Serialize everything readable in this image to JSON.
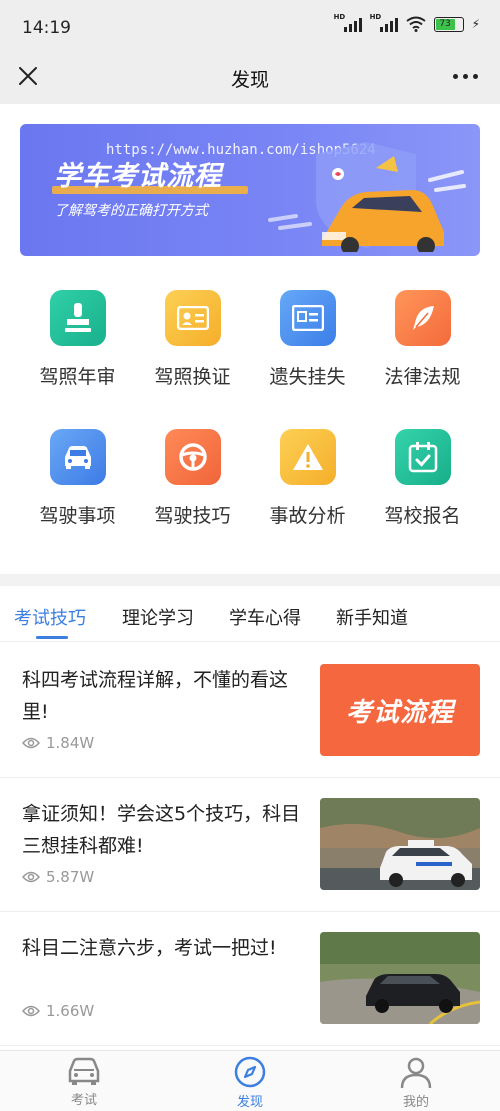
{
  "status_bar": {
    "time": "14:19",
    "battery": "73",
    "hd": "HD"
  },
  "nav": {
    "title": "发现",
    "close_icon": "close-icon",
    "more_icon": "more-icon"
  },
  "banner": {
    "title": "学车考试流程",
    "subtitle": "了解驾考的正确打开方式",
    "watermark": "https://www.huzhan.com/ishop5624"
  },
  "grid": [
    {
      "label": "驾照年审",
      "icon": "stamp-icon",
      "color_from": "#2fd0a7",
      "color_to": "#19b08d"
    },
    {
      "label": "驾照换证",
      "icon": "id-card-icon",
      "color_from": "#fcd055",
      "color_to": "#f5ae2a"
    },
    {
      "label": "遗失挂失",
      "icon": "license-icon",
      "color_from": "#66a8f7",
      "color_to": "#3b7ee8"
    },
    {
      "label": "法律法规",
      "icon": "feather-icon",
      "color_from": "#ff9659",
      "color_to": "#f46a3c"
    },
    {
      "label": "驾驶事项",
      "icon": "car-icon",
      "color_from": "#6aa8f6",
      "color_to": "#3d7be6"
    },
    {
      "label": "驾驶技巧",
      "icon": "steering-wheel-icon",
      "color_from": "#ff8a58",
      "color_to": "#f0653a"
    },
    {
      "label": "事故分析",
      "icon": "warning-icon",
      "color_from": "#fcd055",
      "color_to": "#f5ae2a"
    },
    {
      "label": "驾校报名",
      "icon": "calendar-check-icon",
      "color_from": "#35d4ab",
      "color_to": "#17ae8a"
    }
  ],
  "tabs": [
    {
      "label": "考试技巧",
      "active": true
    },
    {
      "label": "理论学习",
      "active": false
    },
    {
      "label": "学车心得",
      "active": false
    },
    {
      "label": "新手知道",
      "active": false
    }
  ],
  "articles": [
    {
      "title": "科四考试流程详解，不懂的看这里!",
      "views": "1.84W",
      "thumb_text": "考试流程"
    },
    {
      "title": "拿证须知！学会这5个技巧，科目三想挂科都难!",
      "views": "5.87W",
      "thumb_text": ""
    },
    {
      "title": "科目二注意六步，考试一把过!",
      "views": "1.66W",
      "thumb_text": ""
    }
  ],
  "bottom_nav": [
    {
      "label": "考试",
      "icon": "car-front-icon",
      "active": false
    },
    {
      "label": "发现",
      "icon": "compass-icon",
      "active": true
    },
    {
      "label": "我的",
      "icon": "user-icon",
      "active": false
    }
  ],
  "colors": {
    "accent": "#3d7fe0",
    "banner": "#7a86f5",
    "thumb_orange": "#f4673f"
  }
}
